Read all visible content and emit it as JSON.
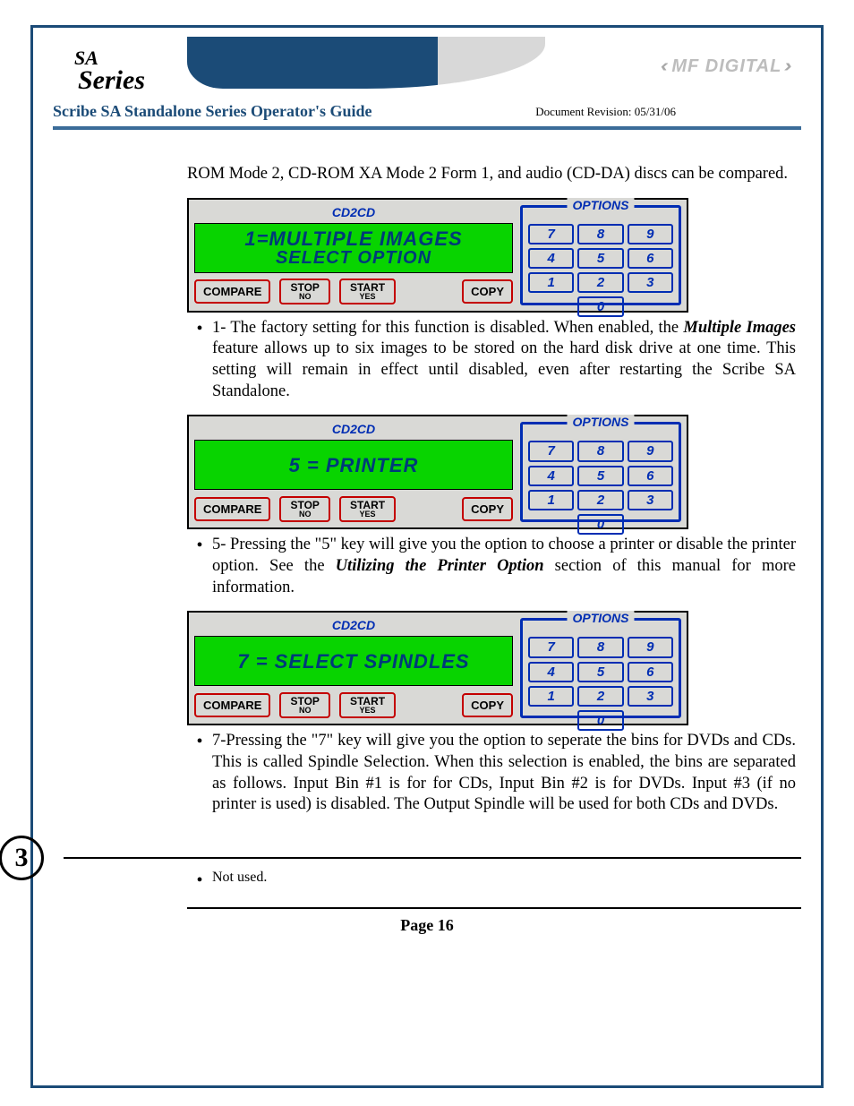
{
  "header": {
    "brand_line1": "SA",
    "brand_line2": "Series",
    "title": "Scribe SA Standalone Series Operator's Guide",
    "revision": "Document Revision: 05/31/06",
    "mf_logo": "MF DIGITAL"
  },
  "intro_para": "ROM Mode 2, CD-ROM XA Mode 2 Form 1, and audio (CD-DA) discs can be compared.",
  "panels": [
    {
      "top": "CD2CD",
      "lcd_line1": "1=MULTIPLE IMAGES",
      "lcd_line2": "SELECT OPTION"
    },
    {
      "top": "CD2CD",
      "lcd_line1": "5 = PRINTER",
      "lcd_line2": ""
    },
    {
      "top": "CD2CD",
      "lcd_line1": "7 = SELECT SPINDLES",
      "lcd_line2": ""
    }
  ],
  "panel_buttons": {
    "compare": "COMPARE",
    "stop": "STOP",
    "stop_sub": "NO",
    "start": "START",
    "start_sub": "YES",
    "copy": "COPY",
    "options_label": "OPTIONS",
    "keys": [
      "7",
      "8",
      "9",
      "4",
      "5",
      "6",
      "1",
      "2",
      "3",
      "0"
    ]
  },
  "bullets": [
    {
      "lead": "1- The factory setting for this function is disabled. When enabled, the ",
      "em": "Multiple Images",
      "tail": " feature allows up to six images to be stored on the hard disk drive at one time. This setting will remain in effect until disabled, even after restarting the Scribe SA Standalone."
    },
    {
      "lead": "5- Pressing the \"5\" key will give you the option to choose a printer or disable the printer option. See the ",
      "em": "Utilizing the Printer Option",
      "tail": " section of this manual for more information."
    },
    {
      "lead": "7-Pressing the \"7\" key will give you the option to seperate the bins for DVDs and CDs.  This is called Spindle Selection.  When this selection is enabled, the bins are separated as follows.  Input Bin #1 is for for CDs, Input Bin #2 is for DVDs. Input #3 (if no printer is used) is disabled.  The Output Spindle will be used for both CDs and DVDs.",
      "em": "",
      "tail": ""
    }
  ],
  "section3": {
    "num": "3",
    "text": "Not used."
  },
  "page_number": "Page 16"
}
